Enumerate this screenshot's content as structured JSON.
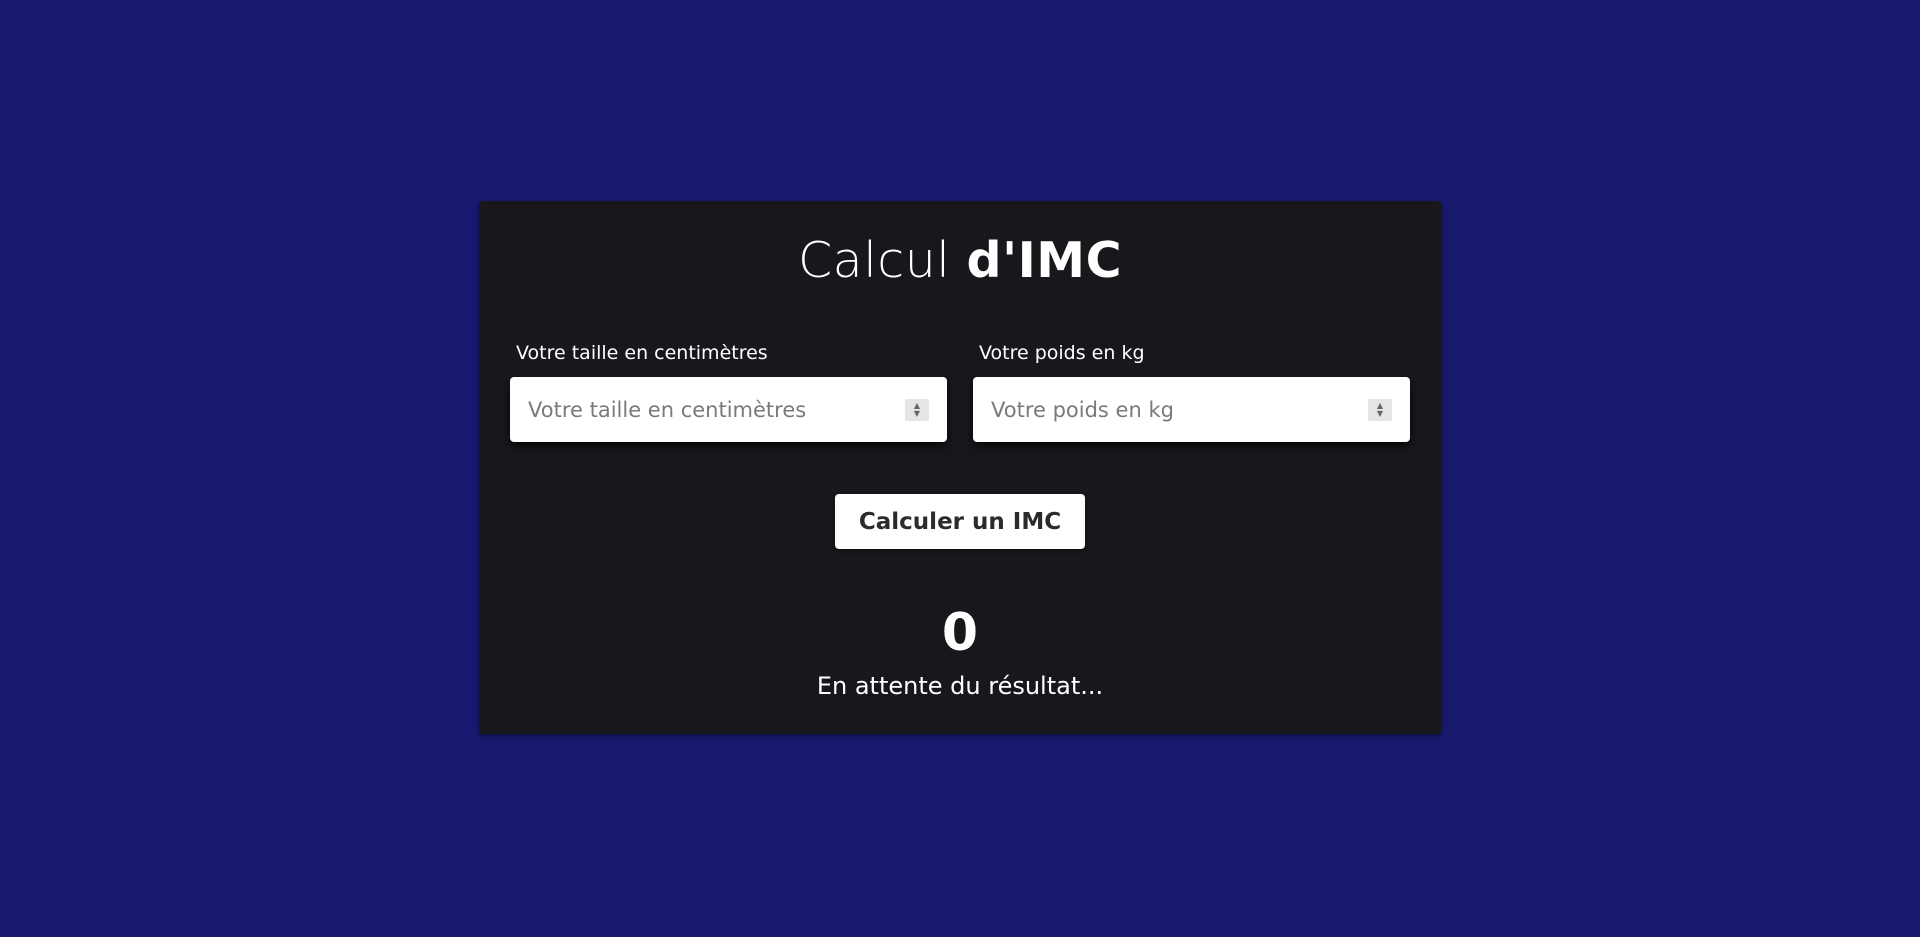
{
  "title": {
    "light": "Calcul",
    "bold": "d'IMC"
  },
  "height_field": {
    "label": "Votre taille en centimètres",
    "placeholder": "Votre taille en centimètres",
    "value": ""
  },
  "weight_field": {
    "label": "Votre poids en kg",
    "placeholder": "Votre poids en kg",
    "value": ""
  },
  "calculate_button": {
    "label": "Calculer un IMC"
  },
  "result": {
    "value": "0",
    "status": "En attente du résultat..."
  },
  "icons": {
    "spinner_up": "▲",
    "spinner_down": "▼"
  },
  "colors": {
    "page_background": "#191970",
    "card_background": "#18171c",
    "text": "#ffffff"
  }
}
